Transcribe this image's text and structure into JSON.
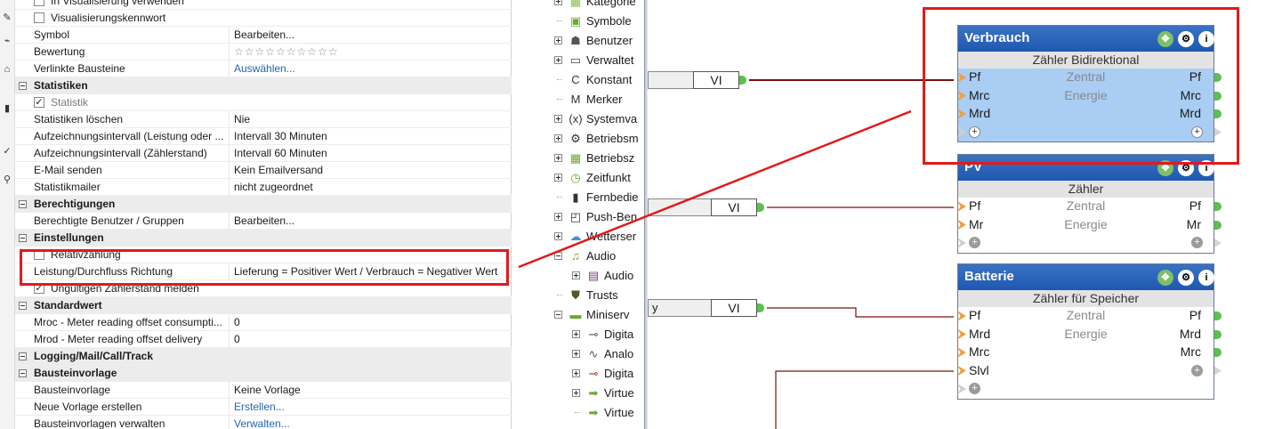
{
  "properties": {
    "rows": [
      {
        "kind": "cb",
        "label": "In Visualisierung verwenden",
        "checked": false
      },
      {
        "kind": "cb",
        "label": "Visualisierungskennwort",
        "checked": false
      },
      {
        "kind": "prop",
        "label": "Symbol",
        "value": "Bearbeiten..."
      },
      {
        "kind": "prop",
        "label": "Bewertung",
        "value": "☆☆☆☆☆☆☆☆☆☆"
      },
      {
        "kind": "prop",
        "label": "Verlinkte Bausteine",
        "value": "Auswählen...",
        "link": true
      },
      {
        "kind": "section",
        "label": "Statistiken"
      },
      {
        "kind": "cb",
        "label": "Statistik",
        "checked": true,
        "dim": true
      },
      {
        "kind": "prop",
        "label": "Statistiken löschen",
        "value": "Nie"
      },
      {
        "kind": "prop",
        "label": "Aufzeichnungsintervall (Leistung oder ...",
        "value": "Intervall 30 Minuten"
      },
      {
        "kind": "prop",
        "label": "Aufzeichnungsintervall (Zählerstand)",
        "value": "Intervall 60 Minuten"
      },
      {
        "kind": "prop",
        "label": "E-Mail senden",
        "value": "Kein Emailversand"
      },
      {
        "kind": "prop",
        "label": "Statistikmailer",
        "value": "nicht zugeordnet"
      },
      {
        "kind": "section",
        "label": "Berechtigungen"
      },
      {
        "kind": "prop",
        "label": "Berechtigte Benutzer / Gruppen",
        "value": "Bearbeiten..."
      },
      {
        "kind": "section",
        "label": "Einstellungen"
      },
      {
        "kind": "cb",
        "label": "Relativzählung",
        "checked": false
      },
      {
        "kind": "prop",
        "label": "Leistung/Durchfluss Richtung",
        "value": "Lieferung = Positiver Wert / Verbrauch = Negativer Wert"
      },
      {
        "kind": "cb",
        "label": "Ungültigen Zählerstand melden",
        "checked": true
      },
      {
        "kind": "section",
        "label": "Standardwert"
      },
      {
        "kind": "prop",
        "label": "Mroc - Meter reading offset consumpti...",
        "value": "0"
      },
      {
        "kind": "prop",
        "label": "Mrod - Meter reading offset delivery",
        "value": "0"
      },
      {
        "kind": "section",
        "label": "Logging/Mail/Call/Track"
      },
      {
        "kind": "section",
        "label": "Bausteinvorlage"
      },
      {
        "kind": "prop",
        "label": "Bausteinvorlage",
        "value": "Keine Vorlage"
      },
      {
        "kind": "prop",
        "label": "Neue Vorlage erstellen",
        "value": "Erstellen...",
        "link": true
      },
      {
        "kind": "prop",
        "label": "Bausteinvorlagen verwalten",
        "value": "Verwalten...",
        "link": true
      }
    ]
  },
  "tree": {
    "items": [
      {
        "label": "Kategorie",
        "icon": "category-icon",
        "glyph": "▦",
        "color": "#8bbd3a",
        "exp": "plus",
        "indent": 0
      },
      {
        "label": "Symbole",
        "icon": "image-icon",
        "glyph": "▣",
        "color": "#6aaa2e",
        "exp": "none",
        "indent": 0
      },
      {
        "label": "Benutzer",
        "icon": "users-icon",
        "glyph": "☗",
        "color": "#555",
        "exp": "plus",
        "indent": 0
      },
      {
        "label": "Verwaltet",
        "icon": "window-icon",
        "glyph": "▭",
        "color": "#444",
        "exp": "plus",
        "indent": 0
      },
      {
        "label": "Konstant",
        "icon": "constant-icon",
        "glyph": "C",
        "color": "#333",
        "exp": "none",
        "indent": 0
      },
      {
        "label": "Merker",
        "icon": "marker-icon",
        "glyph": "M",
        "color": "#333",
        "exp": "none",
        "indent": 0
      },
      {
        "label": "Systemva",
        "icon": "variable-icon",
        "glyph": "(x)",
        "color": "#333",
        "exp": "plus",
        "indent": 0
      },
      {
        "label": "Betriebsm",
        "icon": "gear-icon",
        "glyph": "⚙",
        "color": "#333",
        "exp": "plus",
        "indent": 0
      },
      {
        "label": "Betriebsz",
        "icon": "calendar-icon",
        "glyph": "▦",
        "color": "#6aaa2e",
        "exp": "plus",
        "indent": 0
      },
      {
        "label": "Zeitfunkt",
        "icon": "clock-icon",
        "glyph": "◷",
        "color": "#6aaa2e",
        "exp": "plus",
        "indent": 0
      },
      {
        "label": "Fernbedie",
        "icon": "remote-icon",
        "glyph": "▮",
        "color": "#333",
        "exp": "none",
        "indent": 0
      },
      {
        "label": "Push-Ben",
        "icon": "push-icon",
        "glyph": "◰",
        "color": "#333",
        "exp": "plus",
        "indent": 0
      },
      {
        "label": "Wetterser",
        "icon": "weather-icon",
        "glyph": "☁",
        "color": "#4a8fd6",
        "exp": "plus",
        "indent": 0
      },
      {
        "label": "Audio",
        "icon": "music-icon",
        "glyph": "♫",
        "color": "#6aaa2e",
        "exp": "minus",
        "indent": 0
      },
      {
        "label": "Audio",
        "icon": "audio-player-icon",
        "glyph": "▤",
        "color": "#7a3a7a",
        "exp": "plus",
        "indent": 1
      },
      {
        "label": "Trusts",
        "icon": "shield-icon",
        "glyph": "⛊",
        "color": "#4a5a2a",
        "exp": "none",
        "indent": 0
      },
      {
        "label": "Miniserv",
        "icon": "miniserver-icon",
        "glyph": "▬",
        "color": "#6aaa2e",
        "exp": "minus",
        "indent": 0
      },
      {
        "label": "Digita",
        "icon": "digital-input-icon",
        "glyph": "⊸",
        "color": "#555",
        "exp": "plus",
        "indent": 1
      },
      {
        "label": "Analo",
        "icon": "analog-input-icon",
        "glyph": "∿",
        "color": "#555",
        "exp": "plus",
        "indent": 1
      },
      {
        "label": "Digita",
        "icon": "digital-output-icon",
        "glyph": "⊸",
        "color": "#b33",
        "exp": "plus",
        "indent": 1
      },
      {
        "label": "Virtue",
        "icon": "virtual-input-icon",
        "glyph": "➡",
        "color": "#6aaa2e",
        "exp": "plus",
        "indent": 1
      },
      {
        "label": "Virtue",
        "icon": "virtual-output-icon",
        "glyph": "➡",
        "color": "#6aaa2e",
        "exp": "none",
        "indent": 1
      }
    ]
  },
  "canvas": {
    "vi_label": "VI",
    "vi_left_fragment_1": "",
    "vi_left_fragment_3": "y",
    "blocks": [
      {
        "title": "Verbrauch",
        "subtitle": "Zähler Bidirektional",
        "rows": [
          {
            "l": "Pf",
            "c": "Zentral",
            "r": "Pf"
          },
          {
            "l": "Mrc",
            "c": "Energie",
            "r": "Mrc"
          },
          {
            "l": "Mrd",
            "c": "",
            "r": "Mrd"
          }
        ],
        "add_left": "+",
        "add_right": "+"
      },
      {
        "title": "PV",
        "subtitle": "Zähler",
        "rows": [
          {
            "l": "Pf",
            "c": "Zentral",
            "r": "Pf"
          },
          {
            "l": "Mr",
            "c": "Energie",
            "r": "Mr"
          }
        ],
        "add_left": "+",
        "add_right": "+"
      },
      {
        "title": "Batterie",
        "subtitle": "Zähler für Speicher",
        "rows": [
          {
            "l": "Pf",
            "c": "Zentral",
            "r": "Pf"
          },
          {
            "l": "Mrd",
            "c": "Energie",
            "r": "Mrd"
          },
          {
            "l": "Mrc",
            "c": "",
            "r": "Mrc"
          },
          {
            "l": "Slvl",
            "c": "",
            "r": "+"
          }
        ],
        "add_left": "+",
        "add_right": ""
      }
    ]
  },
  "colors": {
    "annotation_red": "#e01b1b",
    "block_header_blue": "#2a64ba",
    "selection_blue": "#a9cdf3",
    "wire_dark_red": "#7a1010"
  }
}
